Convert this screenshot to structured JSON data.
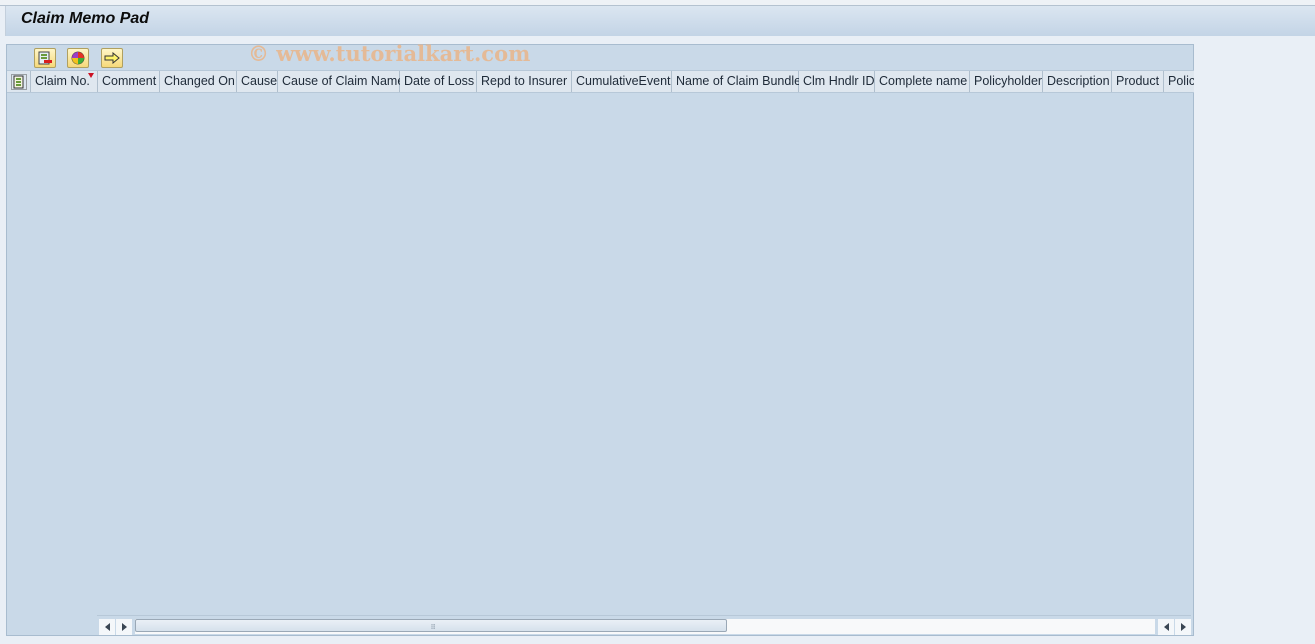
{
  "window": {
    "title": "Claim Memo Pad"
  },
  "toolbar": {
    "buttons": [
      {
        "name": "save-layout",
        "icon": "layout-save-icon"
      },
      {
        "name": "color-legend",
        "icon": "color-wheel-icon"
      },
      {
        "name": "navigate",
        "icon": "arrow-right-icon"
      }
    ]
  },
  "watermark": "© www.tutorialkart.com",
  "table": {
    "columns": [
      "Claim No.",
      "Comment",
      "Changed On",
      "Cause",
      "Cause of Claim Name",
      "Date of Loss",
      "Repd to Insurer",
      "CumulativeEvent",
      "Name of Claim Bundle",
      "Clm Hndlr ID",
      "Complete name",
      "Policyholder",
      "Description",
      "Product",
      "Policy"
    ],
    "sorted_column": "Claim No.",
    "rows": []
  },
  "scrollbar": {
    "horizontal_position": 0.0,
    "visible_fraction": 0.58
  }
}
